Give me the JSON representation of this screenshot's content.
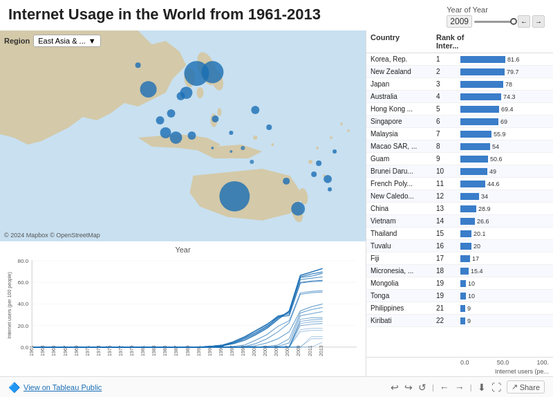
{
  "header": {
    "title": "Internet Usage in the World from 1961-2013",
    "year_label": "Year of Year",
    "year_value": "2009",
    "slider_position": 85
  },
  "region": {
    "label": "Region",
    "selected": "East Asia & ..."
  },
  "map": {
    "attribution": "© 2024 Mapbox  © OpenStreetMap"
  },
  "chart": {
    "title": "Year",
    "y_label": "Internet users (per 100 people)",
    "y_ticks": [
      "80.0",
      "60.0",
      "40.0",
      "20.0",
      "0.0"
    ],
    "x_years": [
      "1961",
      "1963",
      "1965",
      "1967",
      "1969",
      "1971",
      "1973",
      "1975",
      "1977",
      "1979",
      "1981",
      "1983",
      "1985",
      "1987",
      "1989",
      "1991",
      "1993",
      "1995",
      "1997",
      "1999",
      "2001",
      "2003",
      "2005",
      "2007",
      "2009",
      "2011",
      "2013"
    ]
  },
  "table": {
    "col_country": "Country",
    "col_rank": "Rank of Inter...",
    "col_bar": "",
    "max_value": 100,
    "axis_labels": [
      "0.0",
      "50.0",
      "100."
    ],
    "axis_label_full": "Internet users (pe...",
    "rows": [
      {
        "country": "Korea, Rep.",
        "rank": "1",
        "value": 81.6
      },
      {
        "country": "New Zealand",
        "rank": "2",
        "value": 79.7
      },
      {
        "country": "Japan",
        "rank": "3",
        "value": 78.0
      },
      {
        "country": "Australia",
        "rank": "4",
        "value": 74.3
      },
      {
        "country": "Hong Kong ...",
        "rank": "5",
        "value": 69.4
      },
      {
        "country": "Singapore",
        "rank": "6",
        "value": 69.0
      },
      {
        "country": "Malaysia",
        "rank": "7",
        "value": 55.9
      },
      {
        "country": "Macao SAR, ...",
        "rank": "8",
        "value": 54.0
      },
      {
        "country": "Guam",
        "rank": "9",
        "value": 50.6
      },
      {
        "country": "Brunei Daru...",
        "rank": "10",
        "value": 49.0
      },
      {
        "country": "French Poly...",
        "rank": "11",
        "value": 44.6
      },
      {
        "country": "New Caledo...",
        "rank": "12",
        "value": 34.0
      },
      {
        "country": "China",
        "rank": "13",
        "value": 28.9
      },
      {
        "country": "Vietnam",
        "rank": "14",
        "value": 26.6
      },
      {
        "country": "Thailand",
        "rank": "15",
        "value": 20.1
      },
      {
        "country": "Tuvalu",
        "rank": "16",
        "value": 20.0
      },
      {
        "country": "Fiji",
        "rank": "17",
        "value": 17.0
      },
      {
        "country": "Micronesia, ...",
        "rank": "18",
        "value": 15.4
      },
      {
        "country": "Mongolia",
        "rank": "19",
        "value": 10.0
      },
      {
        "country": "Tonga",
        "rank": "19",
        "value": 10.0
      },
      {
        "country": "Philippines",
        "rank": "21",
        "value": 9.0
      },
      {
        "country": "Kiribati",
        "rank": "22",
        "value": 9.0
      }
    ]
  },
  "footer": {
    "view_label": "View on Tableau Public",
    "undo_icon": "↩",
    "redo_icon": "↪",
    "reset_icon": "↺",
    "nav_left": "←",
    "nav_right": "→",
    "download_icon": "⬇",
    "fullscreen_icon": "⛶",
    "share_label": "Share"
  }
}
